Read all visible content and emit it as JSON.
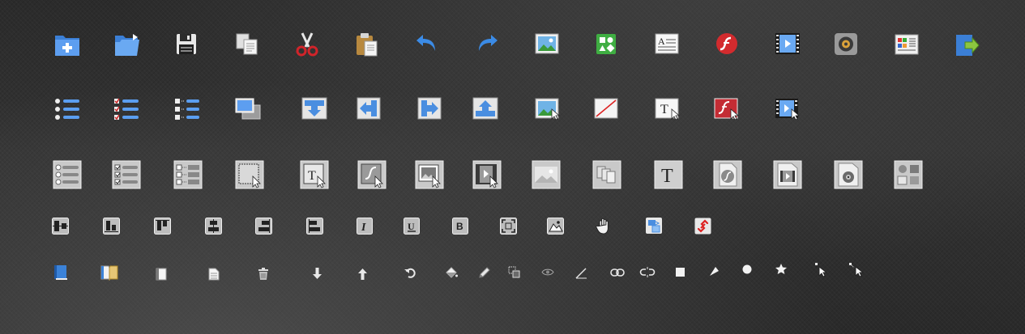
{
  "palette": {
    "blue": "#4a8ee0",
    "blue_light": "#8fc0f5",
    "red": "#c8272a",
    "green": "#3daa3d",
    "gray_tile": "#bdbdbd",
    "background": "#2e2e2e"
  },
  "rows": [
    {
      "name": "toolbar-main",
      "icons": [
        "new-folder-icon",
        "open-folder-icon",
        "save-icon",
        "copy-icon",
        "cut-icon",
        "paste-icon",
        "undo-icon",
        "redo-icon",
        "image-icon",
        "symbol-icon",
        "text-block-icon",
        "flash-icon",
        "video-icon",
        "audio-icon",
        "widget-icon",
        "export-icon"
      ]
    },
    {
      "name": "toolbar-insert",
      "icons": [
        "unordered-list-icon",
        "checklist-icon",
        "tree-list-icon",
        "slideshow-icon",
        "move-down-icon",
        "move-left-icon",
        "move-right-icon",
        "move-up-icon",
        "insert-image-icon",
        "no-fill-icon",
        "insert-text-icon",
        "insert-flash-icon",
        "insert-video-icon"
      ]
    },
    {
      "name": "toolbar-components",
      "icons": [
        "list-panel-icon",
        "check-panel-icon",
        "tree-panel-icon",
        "selection-area-icon",
        "text-area-icon",
        "flash-area-icon",
        "image-area-icon",
        "video-area-icon",
        "picture-panel-icon",
        "gallery-panel-icon",
        "text-panel-icon",
        "flash-file-icon",
        "video-file-icon",
        "audio-file-icon",
        "media-grid-icon"
      ]
    },
    {
      "name": "toolbar-format",
      "icons": [
        "align-middle-icon",
        "align-bottom-icon",
        "align-top-icon",
        "align-center-icon",
        "align-right-icon",
        "align-left-icon",
        "italic-icon",
        "underline-icon",
        "bold-icon",
        "fit-screen-icon",
        "image-frame-icon",
        "hand-tool-icon",
        "transform-icon",
        "link-tool-icon"
      ]
    },
    {
      "name": "toolbar-tools",
      "icons": [
        "book-icon",
        "open-book-icon",
        "page-icon",
        "document-icon",
        "trash-icon",
        "arrow-down-icon",
        "arrow-up-icon",
        "rotate-icon",
        "fill-bucket-icon",
        "pencil-icon",
        "resize-icon",
        "eye-icon",
        "line-tool-icon",
        "link-icon",
        "unlink-icon",
        "square-tool-icon",
        "arrow-point-icon",
        "circle-tool-icon",
        "star-tool-icon",
        "pointer-icon",
        "select-pointer-icon"
      ]
    }
  ]
}
